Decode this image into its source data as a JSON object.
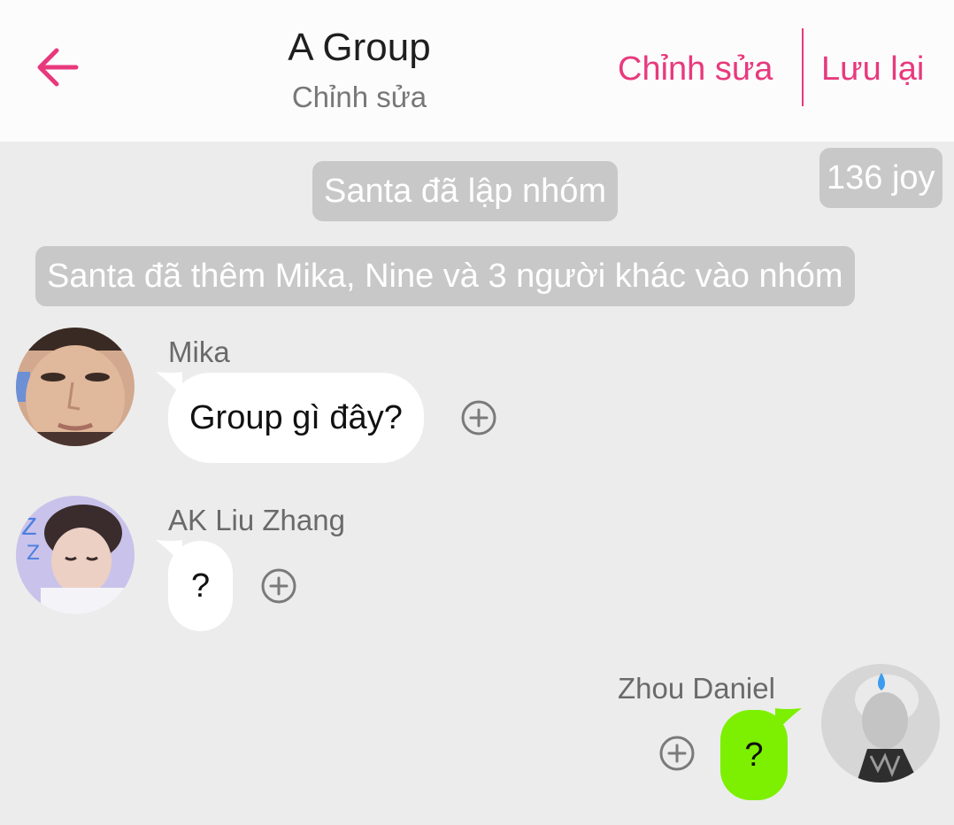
{
  "header": {
    "title": "A Group",
    "subtitle": "Chỉnh sửa",
    "edit_label": "Chỉnh sửa",
    "save_label": "Lưu lại",
    "back_icon": "arrow-left-icon",
    "accent_color": "#e8397d"
  },
  "system_messages": {
    "created": "Santa đã lập nhóm",
    "added": "Santa đã thêm Mika, Nine và 3 người khác vào nhóm"
  },
  "joy_badge": "136 joy",
  "messages": [
    {
      "sender": "Mika",
      "text": "Group gì đây?",
      "outgoing": false,
      "reaction_icon": "add-reaction-icon"
    },
    {
      "sender": "AK Liu Zhang",
      "text": "?",
      "outgoing": false,
      "reaction_icon": "add-reaction-icon"
    },
    {
      "sender": "Zhou Daniel",
      "text": "?",
      "outgoing": true,
      "reaction_icon": "add-reaction-icon"
    }
  ],
  "colors": {
    "chat_background": "#ececec",
    "system_pill": "#c8c8c8",
    "incoming_bubble": "#ffffff",
    "outgoing_bubble": "#7cf000"
  }
}
